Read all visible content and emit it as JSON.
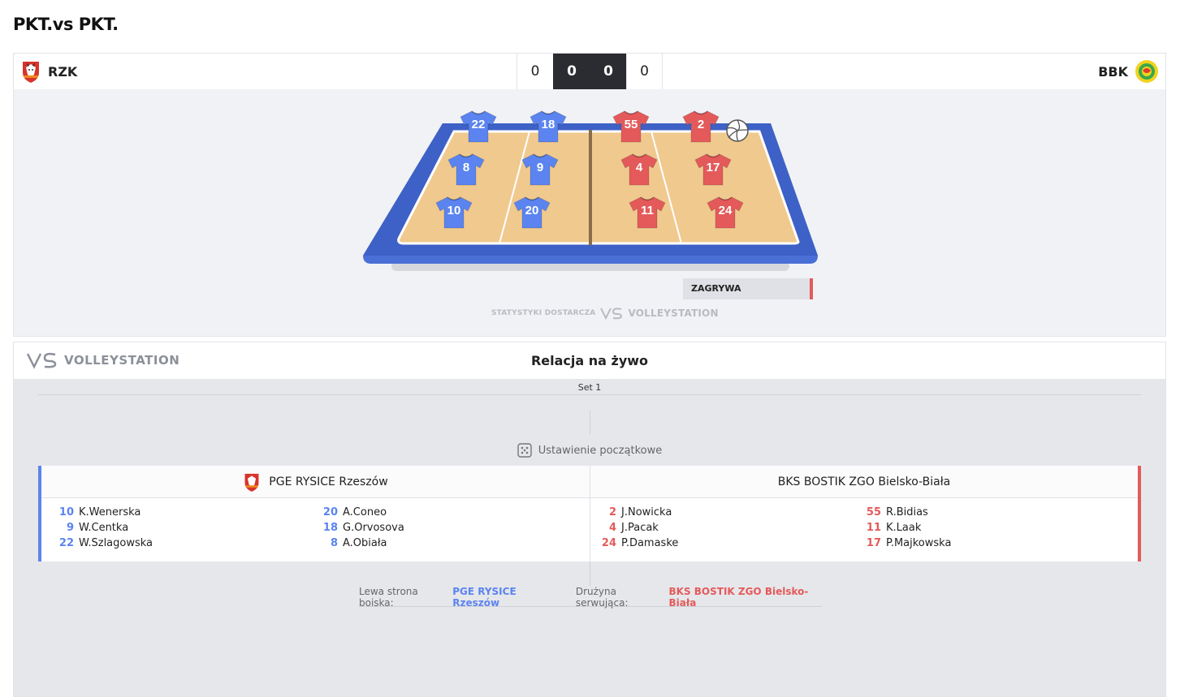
{
  "page": {
    "title": "PKT.vs PKT."
  },
  "scoreboard": {
    "home": {
      "abbr": "RZK"
    },
    "away": {
      "abbr": "BBK"
    },
    "scores": [
      "0",
      "0",
      "0",
      "0"
    ]
  },
  "court": {
    "home_players": [
      {
        "number": "22",
        "row": "net"
      },
      {
        "number": "18",
        "row": "net"
      },
      {
        "number": "8",
        "row": "mid"
      },
      {
        "number": "9",
        "row": "mid"
      },
      {
        "number": "10",
        "row": "back"
      },
      {
        "number": "20",
        "row": "back"
      }
    ],
    "away_players": [
      {
        "number": "55",
        "row": "net"
      },
      {
        "number": "2",
        "row": "net"
      },
      {
        "number": "4",
        "row": "mid"
      },
      {
        "number": "17",
        "row": "mid"
      },
      {
        "number": "11",
        "row": "back"
      },
      {
        "number": "24",
        "row": "back"
      }
    ],
    "serve_label": "ZAGRYWA",
    "provider_prefix": "STATYSTYKI DOSTARCZA",
    "provider_name": "VOLLEYSTATION"
  },
  "colors": {
    "home": "#5b84f0",
    "away": "#e45a5a",
    "court": "#f0c98f",
    "court_edge": "#4a6fd6"
  },
  "live": {
    "brand": "VOLLEYSTATION",
    "title": "Relacja na żywo",
    "set_label": "Set 1",
    "setup_label": "Ustawienie początkowe",
    "home_team": {
      "name": "PGE RYSICE Rzeszów",
      "col1": [
        {
          "num": "10",
          "name": "K.Wenerska"
        },
        {
          "num": "9",
          "name": "W.Centka"
        },
        {
          "num": "22",
          "name": "W.Szlagowska"
        }
      ],
      "col2": [
        {
          "num": "20",
          "name": "A.Coneo"
        },
        {
          "num": "18",
          "name": "G.Orvosova"
        },
        {
          "num": "8",
          "name": "A.Obiała"
        }
      ]
    },
    "away_team": {
      "name": "BKS BOSTIK ZGO Bielsko-Biała",
      "col1": [
        {
          "num": "2",
          "name": "J.Nowicka"
        },
        {
          "num": "4",
          "name": "J.Pacak"
        },
        {
          "num": "24",
          "name": "P.Damaske"
        }
      ],
      "col2": [
        {
          "num": "55",
          "name": "R.Bidias"
        },
        {
          "num": "11",
          "name": "K.Laak"
        },
        {
          "num": "17",
          "name": "P.Majkowska"
        }
      ]
    },
    "left_side_label": "Lewa strona boiska:",
    "left_side_team": "PGE RYSICE Rzeszów",
    "serving_label": "Drużyna serwująca:",
    "serving_team": "BKS BOSTIK ZGO Bielsko-Biała"
  }
}
